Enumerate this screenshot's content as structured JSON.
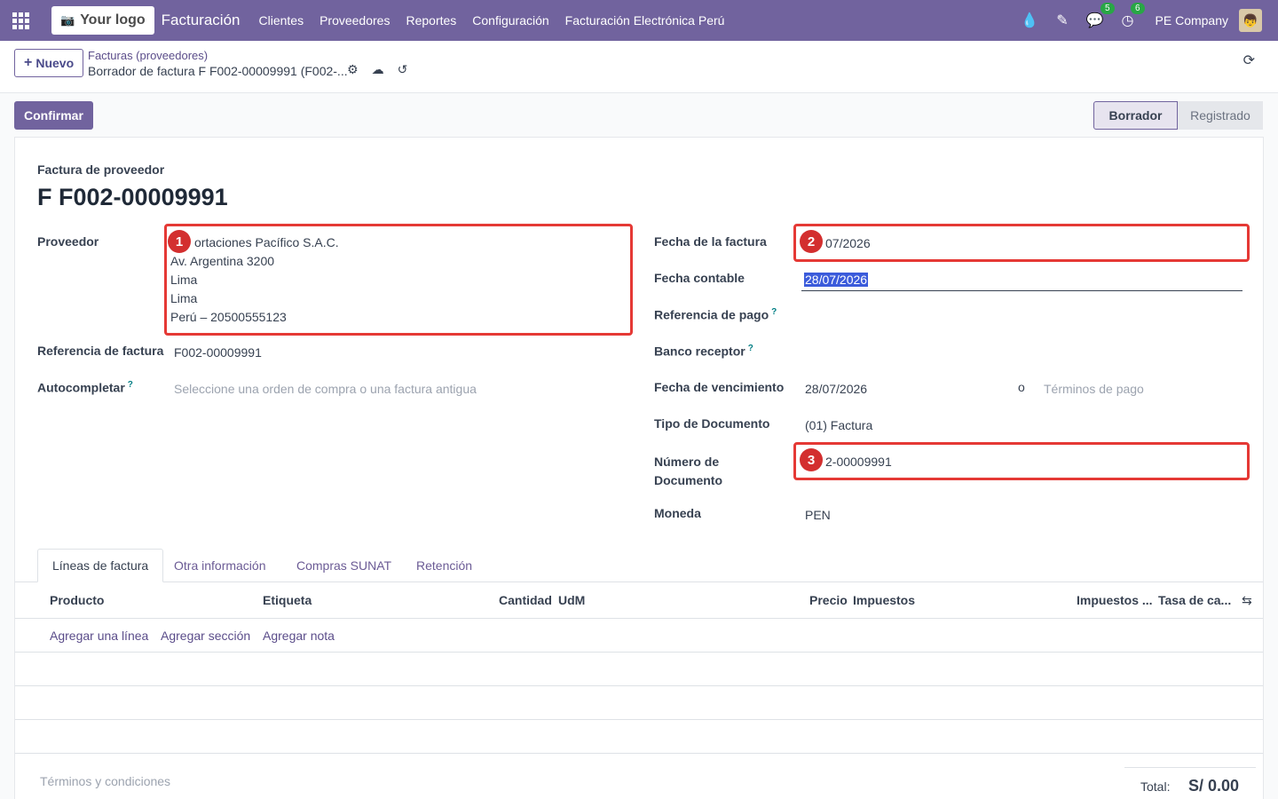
{
  "navbar": {
    "logo_text": "Your logo",
    "app_name": "Facturación",
    "menu": [
      "Clientes",
      "Proveedores",
      "Reportes",
      "Configuración",
      "Facturación Electrónica Perú"
    ],
    "chat_badge": "5",
    "activity_badge": "6",
    "company": "PE Company"
  },
  "control": {
    "new_label": "Nuevo",
    "breadcrumb_parent": "Facturas (proveedores)",
    "breadcrumb_current": "Borrador de factura F F002-00009991 (F002-..."
  },
  "actions": {
    "confirm_label": "Confirmar"
  },
  "status": {
    "current": "Borrador",
    "next": "Registrado"
  },
  "form": {
    "doc_type": "Factura de proveedor",
    "doc_number": "F F002-00009991",
    "left": {
      "vendor_label": "Proveedor",
      "vendor_lines": [
        "ortaciones Pacífico S.A.C.",
        "Av. Argentina 3200",
        "Lima",
        "Lima",
        "Perú – 20500555123"
      ],
      "bill_ref_label": "Referencia de factura",
      "bill_ref_value": "F002-00009991",
      "autocomplete_label": "Autocompletar",
      "autocomplete_placeholder": "Seleccione una orden de compra o una factura antigua"
    },
    "right": {
      "invoice_date_label": "Fecha de la factura",
      "invoice_date_value": "07/2026",
      "accounting_date_label": "Fecha contable",
      "accounting_date_value": "28/07/2026",
      "payment_ref_label": "Referencia de pago",
      "bank_label": "Banco receptor",
      "due_date_label": "Fecha de vencimiento",
      "due_date_value": "28/07/2026",
      "or_text": "o",
      "payment_terms_placeholder": "Términos de pago",
      "doc_type_label": "Tipo de Documento",
      "doc_type_value": "(01) Factura",
      "doc_number_label_1": "Número de",
      "doc_number_label_2": "Documento",
      "doc_number_value": "2-00009991",
      "currency_label": "Moneda",
      "currency_value": "PEN"
    },
    "callouts": [
      "1",
      "2",
      "3"
    ]
  },
  "tabs": [
    "Líneas de factura",
    "Otra información",
    "Compras SUNAT",
    "Retención"
  ],
  "table": {
    "columns": [
      "Producto",
      "Etiqueta",
      "Cantidad",
      "UdM",
      "Precio",
      "Impuestos",
      "Impuestos ...",
      "Tasa de ca..."
    ],
    "add_line": "Agregar una línea",
    "add_section": "Agregar sección",
    "add_note": "Agregar nota"
  },
  "footer": {
    "terms_placeholder": "Términos y condiciones",
    "total_label": "Total:",
    "total_value": "S/ 0.00"
  }
}
